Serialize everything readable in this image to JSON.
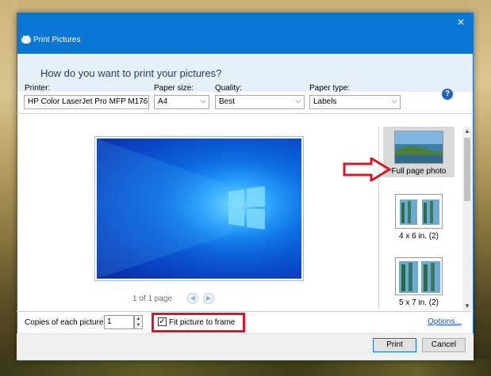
{
  "window": {
    "title": "Print Pictures",
    "close_glyph": "×"
  },
  "header": {
    "question": "How do you want to print your pictures?"
  },
  "fields": {
    "printer_label": "Printer:",
    "printer_value": "HP Color LaserJet Pro MFP M176",
    "paper_size_label": "Paper size:",
    "paper_size_value": "A4",
    "quality_label": "Quality:",
    "quality_value": "Best",
    "paper_type_label": "Paper type:",
    "paper_type_value": "Labels",
    "help_glyph": "?"
  },
  "preview": {
    "page_indicator": "1 of 1 page",
    "prev_glyph": "◀",
    "next_glyph": "▶"
  },
  "layouts": {
    "items": [
      {
        "label": "Full page photo",
        "selected": true
      },
      {
        "label": "4 x 6 in. (2)",
        "selected": false
      },
      {
        "label": "5 x 7 in. (2)",
        "selected": false
      }
    ],
    "scroll_up_glyph": "▲",
    "scroll_down_glyph": "▼"
  },
  "options": {
    "copies_label": "Copies of each picture:",
    "copies_value": "1",
    "fit_label": "Fit picture to frame",
    "fit_checked": true,
    "fit_check_glyph": "✓",
    "options_link": "Options..."
  },
  "buttons": {
    "print": "Print",
    "cancel": "Cancel"
  },
  "colors": {
    "titlebar": "#0b77d4",
    "annotation_red": "#d4182a",
    "link_blue": "#1e57b5"
  }
}
